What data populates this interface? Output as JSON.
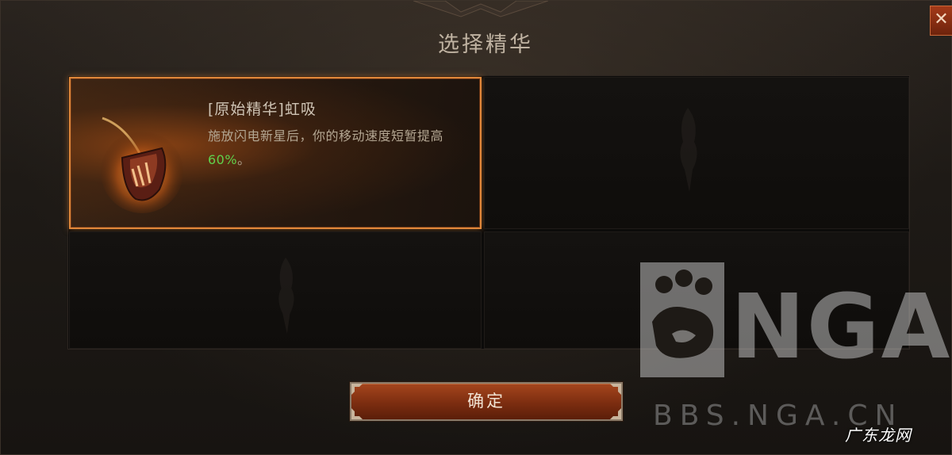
{
  "dialog": {
    "title": "选择精华",
    "close_label": "✕"
  },
  "selected_essence": {
    "name": "[原始精华]虹吸",
    "description_prefix": "施放闪电新星后，你的移动速度短暂提高",
    "description_value": "60%",
    "description_suffix": "。",
    "icon": "essence-claw-shield-icon"
  },
  "empty_slots": [
    {
      "icon": "essence-silhouette-icon"
    },
    {
      "icon": "essence-silhouette-icon"
    },
    {
      "icon": "essence-silhouette-icon"
    }
  ],
  "confirm_button": {
    "label": "确定"
  },
  "watermark": {
    "logo_text": "NGA",
    "url_text": "BBS.NGA.CN",
    "corner_text": "广东龙网"
  },
  "colors": {
    "highlight_green": "#5fd14c",
    "selected_border": "#e0873a",
    "button_red": "#8c3413"
  }
}
